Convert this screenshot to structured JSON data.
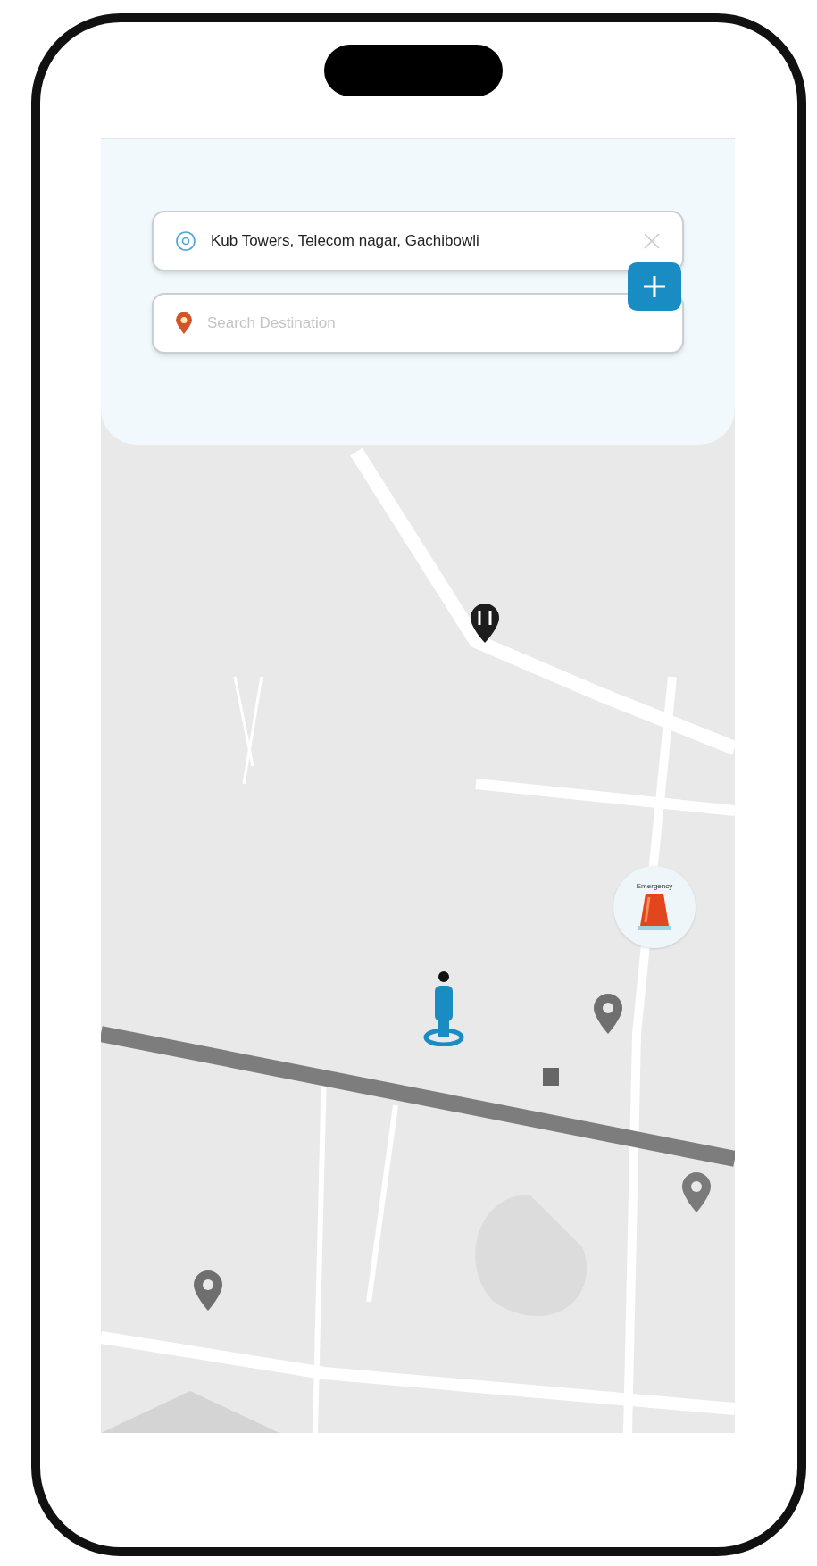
{
  "origin": {
    "value": "Kub Towers, Telecom nagar, Gachibowli"
  },
  "destination": {
    "placeholder": "Search Destination"
  },
  "emergency": {
    "label": "Emergency"
  }
}
